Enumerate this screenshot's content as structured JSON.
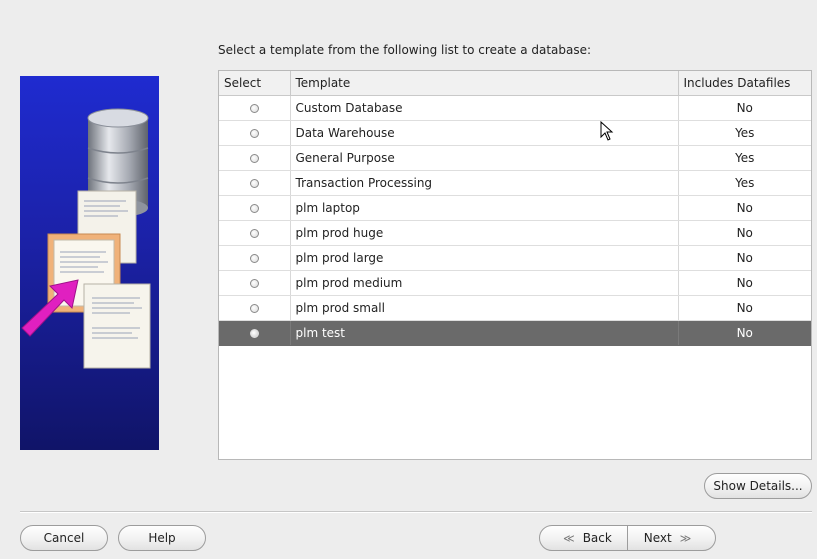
{
  "instruction": "Select a template from the following list to create a database:",
  "table": {
    "headers": {
      "select": "Select",
      "template": "Template",
      "files": "Includes Datafiles"
    },
    "rows": [
      {
        "template": "Custom Database",
        "files": "No",
        "selected": false
      },
      {
        "template": "Data Warehouse",
        "files": "Yes",
        "selected": false
      },
      {
        "template": "General Purpose",
        "files": "Yes",
        "selected": false
      },
      {
        "template": "Transaction Processing",
        "files": "Yes",
        "selected": false
      },
      {
        "template": "plm laptop",
        "files": "No",
        "selected": false
      },
      {
        "template": "plm prod huge",
        "files": "No",
        "selected": false
      },
      {
        "template": "plm prod large",
        "files": "No",
        "selected": false
      },
      {
        "template": "plm prod medium",
        "files": "No",
        "selected": false
      },
      {
        "template": "plm prod small",
        "files": "No",
        "selected": false
      },
      {
        "template": "plm test",
        "files": "No",
        "selected": true
      }
    ]
  },
  "buttons": {
    "show_details": "Show Details...",
    "cancel": "Cancel",
    "help": "Help",
    "back": "Back",
    "next": "Next"
  },
  "colors": {
    "selected_row": "#6a6a6a",
    "graphic_blue": "#1b21a6",
    "arrow": "#e020c0"
  }
}
